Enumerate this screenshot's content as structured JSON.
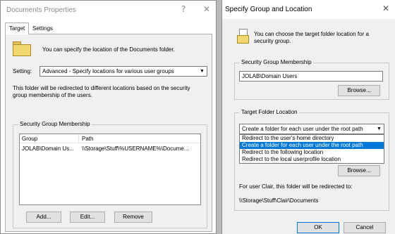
{
  "left_dialog": {
    "title": "Documents Properties",
    "help_glyph": "?",
    "close_glyph": "✕",
    "tabs": [
      {
        "label": "Target"
      },
      {
        "label": "Settings"
      }
    ],
    "intro": "You can specify the location of the Documents folder.",
    "setting_label": "Setting:",
    "setting_value": "Advanced - Specify locations for various user groups",
    "description": "This folder will be redirected to different locations based on the security group membership of the users.",
    "group_box_title": "Security Group Membership",
    "columns": [
      "Group",
      "Path"
    ],
    "rows": [
      {
        "group": "JOLAB\\Domain Us...",
        "path": "\\\\Storage\\Stuff\\%USERNAME%\\Docume..."
      }
    ],
    "buttons": {
      "add": "Add...",
      "edit": "Edit...",
      "remove": "Remove"
    }
  },
  "right_dialog": {
    "title": "Specify Group and Location",
    "close_glyph": "✕",
    "intro": "You can choose the target folder location for a security group.",
    "membership_title": "Security Group Membership",
    "membership_value": "JOLAB\\Domain Users",
    "browse1": "Browse...",
    "target_title": "Target Folder Location",
    "target_value": "Create a folder for each user under the root path",
    "options": [
      "Redirect to the user's home directory",
      "Create a folder for each user under the root path",
      "Redirect to the following location",
      "Redirect to the local userprofile location"
    ],
    "selected_option_index": 1,
    "browse2": "Browse...",
    "redirect_text": "For user Clair, this folder will be redirected to:",
    "path_text": "\\\\Storage\\Stuff\\Clair\\Documents",
    "ok": "OK",
    "cancel": "Cancel"
  }
}
